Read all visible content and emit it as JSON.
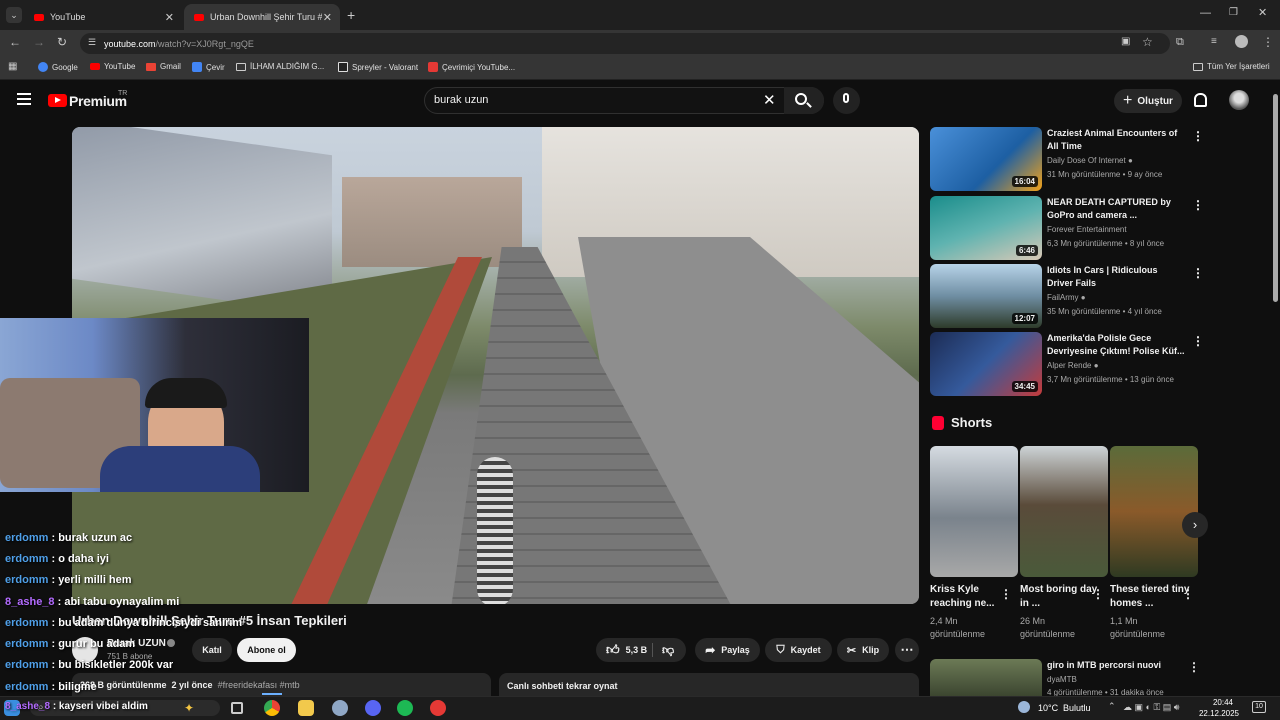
{
  "browser": {
    "tabs": [
      {
        "label": "YouTube"
      },
      {
        "label": "Urban Downhill Şehir Turu #5 İ"
      }
    ],
    "url": "youtube.com",
    "url_path": "/watch?v=XJ0Rgt_ngQE",
    "bookmarks": [
      {
        "label": "Google"
      },
      {
        "label": "YouTube"
      },
      {
        "label": "Gmail"
      },
      {
        "label": "Çevir"
      },
      {
        "label": "İLHAM ALDIĞIM G..."
      },
      {
        "label": "Spreyler - Valorant"
      },
      {
        "label": "Çevrimiçi YouTube..."
      }
    ],
    "all_bookmarks": "Tüm Yer İşaretleri"
  },
  "youtube": {
    "logo": "Premium",
    "logo_sup": "TR",
    "search_value": "burak uzun",
    "create_label": "Oluştur"
  },
  "chat": [
    {
      "user": "erdomm",
      "msg": ": burak uzun ac"
    },
    {
      "user": "erdomm",
      "msg": ": o daha iyi"
    },
    {
      "user": "erdomm",
      "msg": ": yerli milli hem"
    },
    {
      "user": "8_ashe_8",
      "msg": ": abi tabu oynayalim mi"
    },
    {
      "user": "erdomm",
      "msg": ": bu adam dunya birincisiydi sanirim"
    },
    {
      "user": "erdomm",
      "msg": ": gurur bu adam"
    },
    {
      "user": "erdomm",
      "msg": ": bu bisikletler 200k var"
    },
    {
      "user": "erdomm",
      "msg": ": biligme"
    },
    {
      "user": "8_ashe_8",
      "msg": ": kayseri vibei aldim"
    }
  ],
  "video": {
    "title": "Urban Downhill Şehir Turu #5 İnsan Tepkileri",
    "channel": "Burak UZUN",
    "subscribers": "751 B abone",
    "join_label": "Katıl",
    "subscribe_label": "Abone ol",
    "likes": "5,3 B",
    "share_label": "Paylaş",
    "save_label": "Kaydet",
    "clip_label": "Klip",
    "views": "268 B görüntülenme",
    "age": "2 yıl önce",
    "tags": "#freeridekafası #mtb",
    "live_chat": "Canlı sohbeti tekrar oynat"
  },
  "recommendations": [
    {
      "title": "Craziest Animal Encounters of All Time",
      "channel": "Daily Dose Of Internet",
      "meta": "31 Mn görüntülenme • 9 ay önce",
      "duration": "16:04",
      "verified": true,
      "color": "#3a79b8"
    },
    {
      "title": "NEAR DEATH CAPTURED by GoPro and camera ...",
      "channel": "Forever Entertainment",
      "meta": "6,3 Mn görüntülenme • 8 yıl önce",
      "duration": "6:46",
      "verified": false,
      "color": "#2f8c86"
    },
    {
      "title": "Idiots In Cars | Ridiculous Driver Fails",
      "channel": "FailArmy",
      "meta": "35 Mn görüntülenme • 4 yıl önce",
      "duration": "12:07",
      "verified": true,
      "color": "#5d7f99"
    },
    {
      "title": "Amerika'da Polisle Gece Devriyesine Çıktım! Polise Küf...",
      "channel": "Alper Rende",
      "meta": "3,7 Mn görüntülenme • 13 gün önce",
      "duration": "34:45",
      "verified": true,
      "color": "#2d4a7a"
    }
  ],
  "shorts": {
    "heading": "Shorts",
    "items": [
      {
        "title": "Kriss Kyle reaching ne...",
        "views": "2,4 Mn görüntülenme",
        "color": "#6e7a85"
      },
      {
        "title": "Most boring day in ...",
        "views": "26 Mn görüntülenme",
        "color": "#4b5a3a"
      },
      {
        "title": "These tiered tiny homes ...",
        "views": "1,1 Mn görüntülenme",
        "color": "#3d4a2c"
      }
    ]
  },
  "next_rec": {
    "title": "giro in MTB percorsi nuovi",
    "channel": "dyaMTB",
    "meta": "4 görüntülenme • 31 dakika önce"
  },
  "taskbar": {
    "weather": "10°C",
    "weather_desc": "Bulutlu",
    "time": "20:44",
    "date": "22.12.2025",
    "notif_count": "10"
  }
}
